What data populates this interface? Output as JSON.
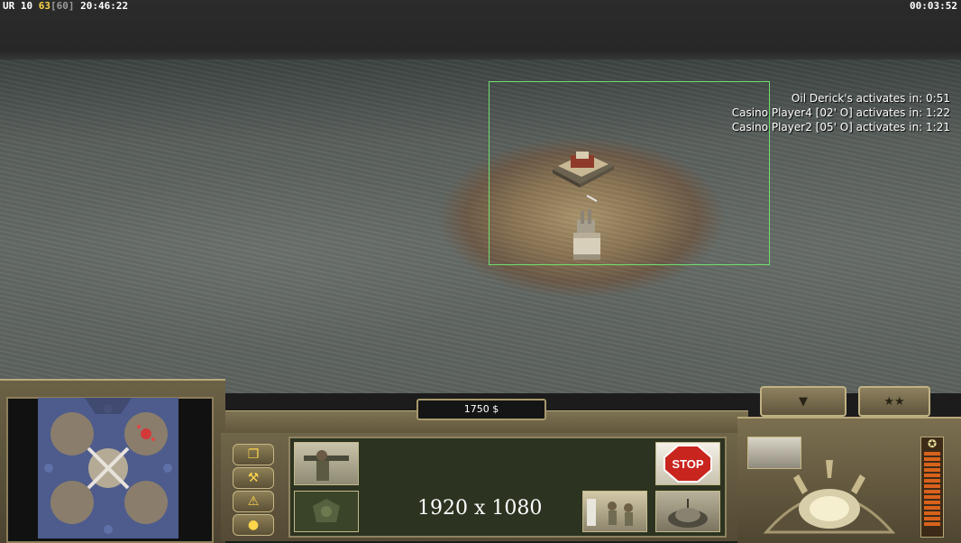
{
  "debug": {
    "prefix": "UR 10",
    "fps": "63",
    "fps_cap": "[60]",
    "clock": "20:46:22"
  },
  "game_timer": "00:03:52",
  "timers": [
    "Oil Derick's activates in: 0:51",
    "Casino Player4 [02' O] activates in: 1:22",
    "Casino Player2 [05' O] activates in: 1:21"
  ],
  "money": "1750 $",
  "resolution_label": "1920 x 1080",
  "stop_label": "STOP",
  "rank_stars": "★★",
  "colors": {
    "selection": "#6fe06f",
    "fps": "#ffd84a",
    "power": "#d8621c"
  },
  "icons": {
    "side_buttons": [
      "windows-icon",
      "wrench-hammer-icon",
      "alert-icon",
      "chat-icon"
    ]
  }
}
